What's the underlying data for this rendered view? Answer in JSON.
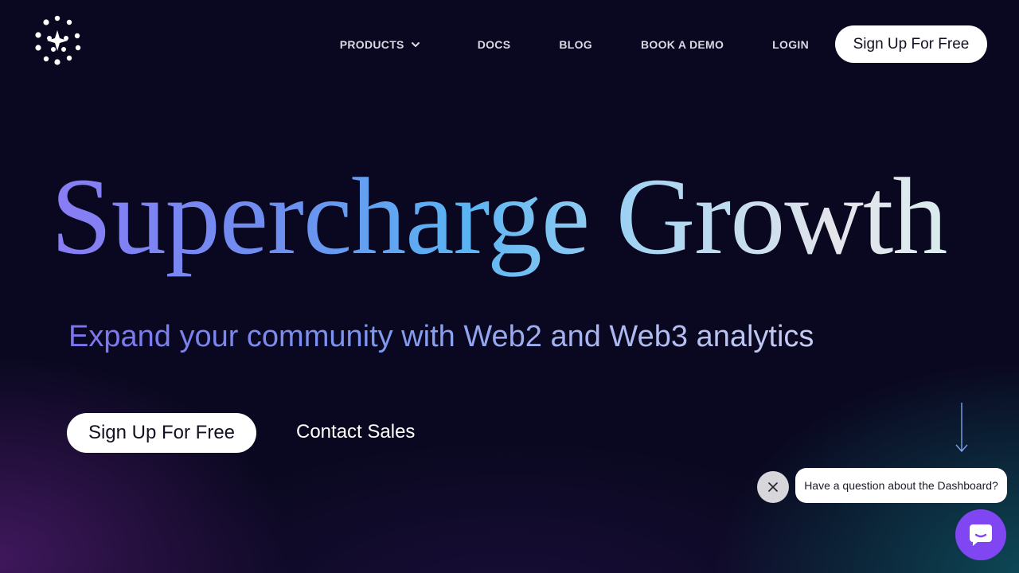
{
  "brand": {
    "logo_icon": "dotted-sparkle-logo-icon"
  },
  "nav": {
    "products": "PRODUCTS",
    "docs": "DOCS",
    "blog": "BLOG",
    "book_demo": "BOOK A DEMO",
    "login": "LOGIN",
    "signup": "Sign Up For Free"
  },
  "hero": {
    "title": "Supercharge Growth",
    "subtitle": "Expand your community with Web2 and Web3 analytics",
    "cta_primary": "Sign Up For Free",
    "cta_secondary": "Contact Sales"
  },
  "chat": {
    "prompt": "Have a question about the Dashboard?",
    "launcher_color": "#7f46f2"
  },
  "colors": {
    "background": "#0a0820",
    "gradient_start": "#8a7cf5",
    "gradient_mid": "#5ab4f2",
    "gradient_end": "#e4e4ea"
  }
}
